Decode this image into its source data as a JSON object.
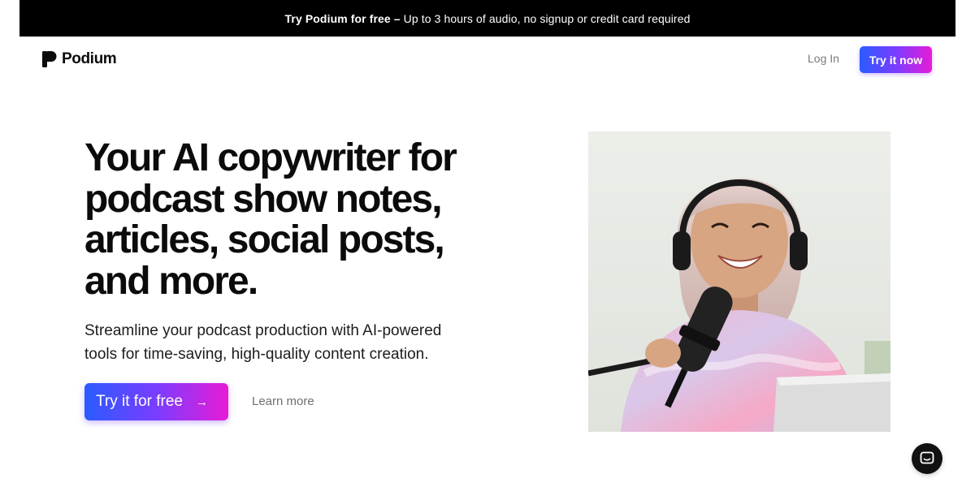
{
  "announcement": {
    "bold": "Try Podium for free –",
    "text": "Up to 3 hours of audio, no signup or credit card required"
  },
  "header": {
    "brand": "Podium",
    "login_label": "Log In",
    "try_now_label": "Try it now"
  },
  "hero": {
    "title": "Your AI copywriter for podcast show notes, articles, social posts, and more.",
    "subtitle": "Streamline your podcast production with AI-powered tools for time-saving, high-quality content creation.",
    "cta_label": "Try it for free",
    "cta_icon": "arrow-right-icon",
    "learn_more_label": "Learn more"
  },
  "photo": {
    "icon": "podcaster-photo"
  },
  "chat": {
    "icon": "chat-bubble-icon"
  },
  "colors": {
    "gradient_start": "#2a5bff",
    "gradient_mid": "#7a3dff",
    "gradient_end": "#e81bd6",
    "announcement_bg": "#000000",
    "text": "#0b0b0b"
  }
}
